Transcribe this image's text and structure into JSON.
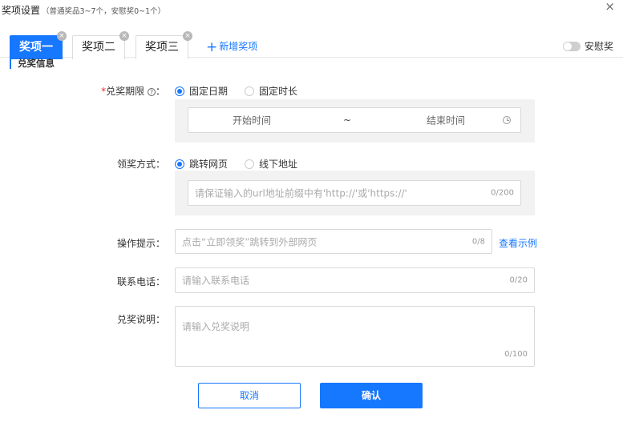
{
  "dialog": {
    "title": "奖项设置",
    "subtitle": "（普通奖品3~7个，安慰奖0~1个）",
    "close_glyph": "×"
  },
  "tabs": [
    {
      "label": "奖项一",
      "active": true
    },
    {
      "label": "奖项二",
      "active": false
    },
    {
      "label": "奖项三",
      "active": false
    }
  ],
  "tab_close_glyph": "×",
  "add_prize": {
    "plus": "+",
    "label": "新增奖项"
  },
  "consolation": {
    "label": "安慰奖",
    "enabled": false
  },
  "section_title": "兑奖信息",
  "redeem_period": {
    "required_mark": "*",
    "label": "兑奖期限",
    "help_glyph": "?",
    "colon": "：",
    "options": [
      "固定日期",
      "固定时长"
    ],
    "selected": "固定日期",
    "start_placeholder": "开始时间",
    "separator": "~",
    "end_placeholder": "结束时间"
  },
  "claim_method": {
    "label": "领奖方式：",
    "options": [
      "跳转网页",
      "线下地址"
    ],
    "selected": "跳转网页",
    "url_placeholder": "请保证输入的url地址前缀中有'http://'或'https://'",
    "url_count": "0/200"
  },
  "operation_tip": {
    "label": "操作提示：",
    "placeholder": "点击“立即领奖”跳转到外部网页",
    "count": "0/8",
    "example_link": "查看示例"
  },
  "phone": {
    "label": "联系电话：",
    "placeholder": "请输入联系电话",
    "count": "0/20"
  },
  "description": {
    "label": "兑奖说明：",
    "placeholder": "请输入兑奖说明",
    "count": "0/100"
  },
  "footer": {
    "cancel_label": "取消",
    "confirm_label": "确认"
  },
  "colors": {
    "primary": "#1677ff",
    "required": "#f5222d"
  },
  "icons": [
    "close-icon",
    "tab-close-icon",
    "plus-icon",
    "toggle-switch",
    "help-icon",
    "clock-icon"
  ]
}
